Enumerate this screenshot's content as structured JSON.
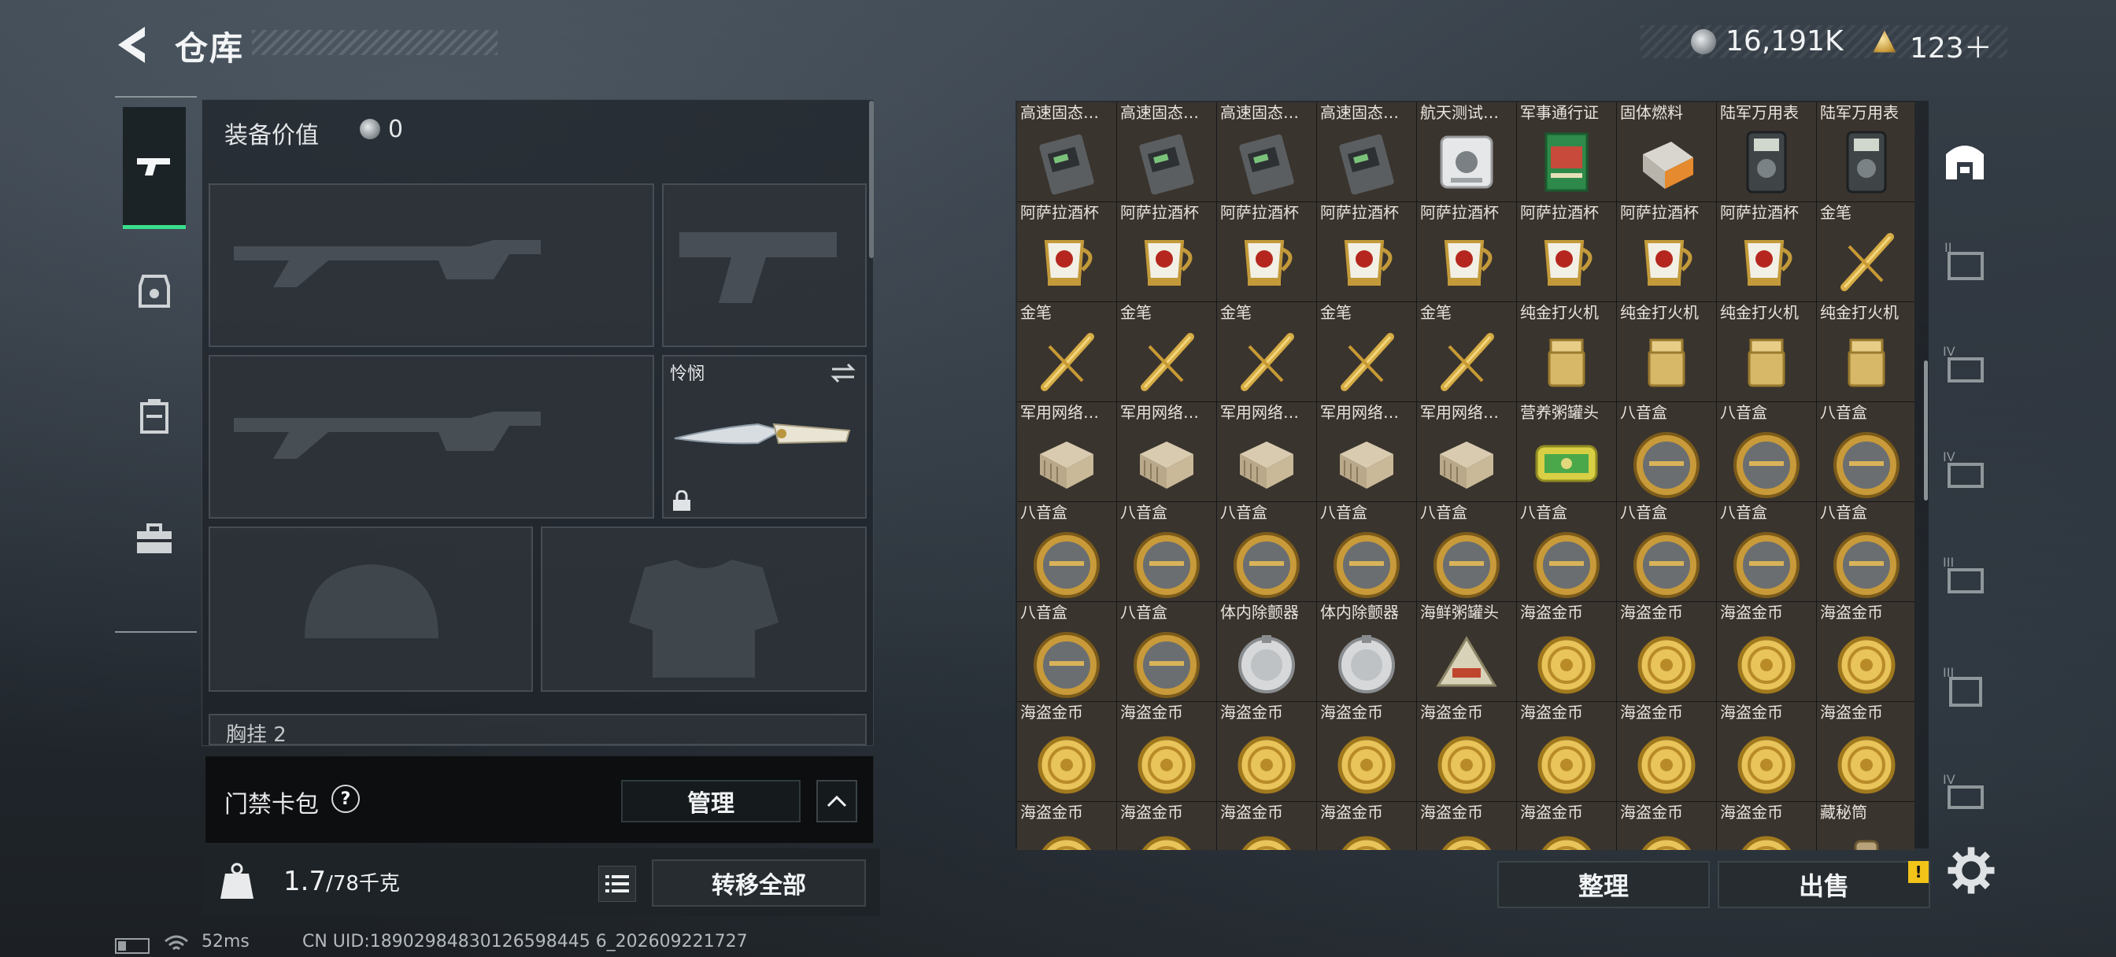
{
  "header": {
    "title": "仓库"
  },
  "currency": {
    "silver": "16,191K",
    "gold": "123＋"
  },
  "equipment": {
    "value_label": "装备价值",
    "value": "0",
    "melee_label": "怜悯",
    "chest_label": "胸挂 2"
  },
  "keycard": {
    "label": "门禁卡包",
    "help": "?",
    "manage": "管理"
  },
  "weight": {
    "current": "1.7",
    "max": "/78千克"
  },
  "actions": {
    "transfer_all": "转移全部",
    "sort": "整理",
    "sell": "出售",
    "alert": "!"
  },
  "status_bar": {
    "ping": "52ms",
    "uid": "CN UID:18902984830126598445 6_202609221727"
  },
  "inventory": [
    {
      "label": "高速固态…",
      "icon": "ssd"
    },
    {
      "label": "高速固态…",
      "icon": "ssd"
    },
    {
      "label": "高速固态…",
      "icon": "ssd"
    },
    {
      "label": "高速固态…",
      "icon": "ssd"
    },
    {
      "label": "航天测试…",
      "icon": "test-device"
    },
    {
      "label": "军事通行证",
      "icon": "pass-book"
    },
    {
      "label": "固体燃料",
      "icon": "fuel"
    },
    {
      "label": "陆军万用表",
      "icon": "multimeter"
    },
    {
      "label": "陆军万用表",
      "icon": "multimeter"
    },
    {
      "label": "阿萨拉酒杯",
      "icon": "goblet"
    },
    {
      "label": "阿萨拉酒杯",
      "icon": "goblet"
    },
    {
      "label": "阿萨拉酒杯",
      "icon": "goblet"
    },
    {
      "label": "阿萨拉酒杯",
      "icon": "goblet"
    },
    {
      "label": "阿萨拉酒杯",
      "icon": "goblet"
    },
    {
      "label": "阿萨拉酒杯",
      "icon": "goblet"
    },
    {
      "label": "阿萨拉酒杯",
      "icon": "goblet"
    },
    {
      "label": "阿萨拉酒杯",
      "icon": "goblet"
    },
    {
      "label": "金笔",
      "icon": "pen"
    },
    {
      "label": "金笔",
      "icon": "pen"
    },
    {
      "label": "金笔",
      "icon": "pen"
    },
    {
      "label": "金笔",
      "icon": "pen"
    },
    {
      "label": "金笔",
      "icon": "pen"
    },
    {
      "label": "金笔",
      "icon": "pen"
    },
    {
      "label": "纯金打火机",
      "icon": "lighter"
    },
    {
      "label": "纯金打火机",
      "icon": "lighter"
    },
    {
      "label": "纯金打火机",
      "icon": "lighter"
    },
    {
      "label": "纯金打火机",
      "icon": "lighter"
    },
    {
      "label": "军用网络…",
      "icon": "network-box"
    },
    {
      "label": "军用网络…",
      "icon": "network-box"
    },
    {
      "label": "军用网络…",
      "icon": "network-box"
    },
    {
      "label": "军用网络…",
      "icon": "network-box"
    },
    {
      "label": "军用网络…",
      "icon": "network-box"
    },
    {
      "label": "营养粥罐头",
      "icon": "can"
    },
    {
      "label": "八音盒",
      "icon": "music-box"
    },
    {
      "label": "八音盒",
      "icon": "music-box"
    },
    {
      "label": "八音盒",
      "icon": "music-box"
    },
    {
      "label": "八音盒",
      "icon": "music-box"
    },
    {
      "label": "八音盒",
      "icon": "music-box"
    },
    {
      "label": "八音盒",
      "icon": "music-box"
    },
    {
      "label": "八音盒",
      "icon": "music-box"
    },
    {
      "label": "八音盒",
      "icon": "music-box"
    },
    {
      "label": "八音盒",
      "icon": "music-box"
    },
    {
      "label": "八音盒",
      "icon": "music-box"
    },
    {
      "label": "八音盒",
      "icon": "music-box"
    },
    {
      "label": "八音盒",
      "icon": "music-box"
    },
    {
      "label": "八音盒",
      "icon": "music-box"
    },
    {
      "label": "八音盒",
      "icon": "music-box"
    },
    {
      "label": "体内除颤器",
      "icon": "defibrillator"
    },
    {
      "label": "体内除颤器",
      "icon": "defibrillator"
    },
    {
      "label": "海鲜粥罐头",
      "icon": "seafood-can"
    },
    {
      "label": "海盗金币",
      "icon": "gold-coin"
    },
    {
      "label": "海盗金币",
      "icon": "gold-coin"
    },
    {
      "label": "海盗金币",
      "icon": "gold-coin"
    },
    {
      "label": "海盗金币",
      "icon": "gold-coin"
    },
    {
      "label": "海盗金币",
      "icon": "gold-coin"
    },
    {
      "label": "海盗金币",
      "icon": "gold-coin"
    },
    {
      "label": "海盗金币",
      "icon": "gold-coin"
    },
    {
      "label": "海盗金币",
      "icon": "gold-coin"
    },
    {
      "label": "海盗金币",
      "icon": "gold-coin"
    },
    {
      "label": "海盗金币",
      "icon": "gold-coin"
    },
    {
      "label": "海盗金币",
      "icon": "gold-coin"
    },
    {
      "label": "海盗金币",
      "icon": "gold-coin"
    },
    {
      "label": "海盗金币",
      "icon": "gold-coin"
    },
    {
      "label": "海盗金币",
      "icon": "gold-coin"
    },
    {
      "label": "海盗金币",
      "icon": "gold-coin"
    },
    {
      "label": "海盗金币",
      "icon": "gold-coin"
    },
    {
      "label": "海盗金币",
      "icon": "gold-coin"
    },
    {
      "label": "海盗金币",
      "icon": "gold-coin"
    },
    {
      "label": "海盗金币",
      "icon": "gold-coin"
    },
    {
      "label": "海盗金币",
      "icon": "gold-coin"
    },
    {
      "label": "海盗金币",
      "icon": "gold-coin"
    },
    {
      "label": "藏秘筒",
      "icon": "cryptex"
    }
  ]
}
